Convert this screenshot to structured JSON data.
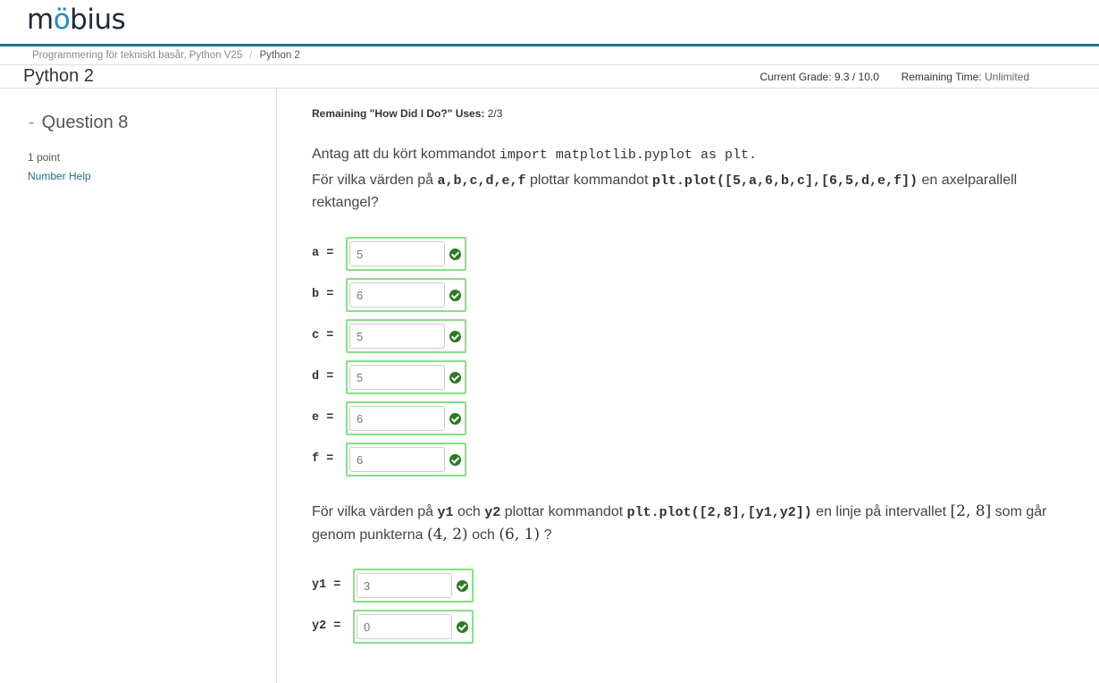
{
  "header": {
    "logo_text": "möbius"
  },
  "breadcrumb": {
    "course": "Programmering för tekniskt basår, Python V25",
    "current": "Python 2"
  },
  "page": {
    "title": "Python 2",
    "grade_label": "Current Grade:",
    "grade_value": "9.3 / 10.0",
    "time_label": "Remaining Time:",
    "time_value": "Unlimited"
  },
  "question": {
    "heading": "Question 8",
    "points": "1 point",
    "number_help": "Number Help"
  },
  "main": {
    "remaining_label": "Remaining \"How Did I Do?\" Uses:",
    "remaining_value": "2/3",
    "p1_text": "Antag att du kört kommandot",
    "p1_code": "import matplotlib.pyplot as plt.",
    "p2_text_a": "För vilka värden på",
    "p2_vars": "a,b,c,d,e,f",
    "p2_text_b": "plottar kommandot",
    "p2_code": "plt.plot([5,a,6,b,c],[6,5,d,e,f])",
    "p2_text_c": "en axelparallell rektangel?",
    "p3_text_a": "För vilka värden på",
    "p3_var1": "y1",
    "p3_and": "och",
    "p3_var2": "y2",
    "p3_text_b": "plottar kommandot",
    "p3_code": "plt.plot([2,8],[y1,y2])",
    "p3_text_c": "en linje på intervallet",
    "p3_interval": "[2, 8]",
    "p3_text_d": "som går genom punkterna",
    "p3_point1": "(4, 2)",
    "p3_and2": "och",
    "p3_point2": "(6, 1)",
    "p3_q": "?"
  },
  "fields": [
    {
      "label": "a =",
      "value": "5"
    },
    {
      "label": "b =",
      "value": "6"
    },
    {
      "label": "c =",
      "value": "5"
    },
    {
      "label": "d =",
      "value": "5"
    },
    {
      "label": "e =",
      "value": "6"
    },
    {
      "label": "f =",
      "value": "6"
    }
  ],
  "fields2": [
    {
      "label": "y1 =",
      "value": "3"
    },
    {
      "label": "y2 =",
      "value": "0"
    }
  ],
  "colors": {
    "accent_rule": "#1f7390",
    "link": "#1f6f8b",
    "correct_border": "#85e085",
    "correct_check": "#2d7a1f"
  },
  "icons": {
    "correct": "check-circle-icon"
  }
}
